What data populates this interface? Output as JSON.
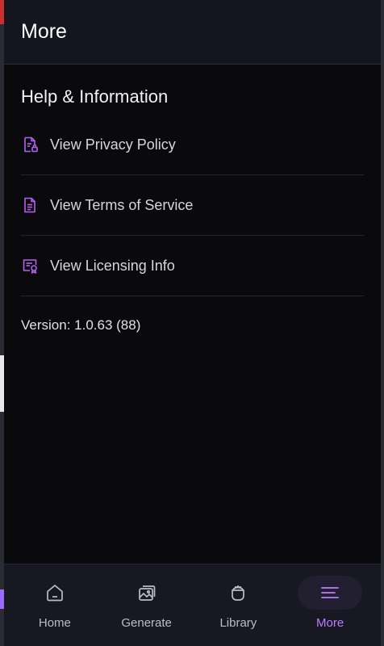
{
  "header": {
    "title": "More"
  },
  "section": {
    "title": "Help & Information"
  },
  "items": [
    {
      "label": "View Privacy Policy",
      "icon": "privacy-policy-icon"
    },
    {
      "label": "View Terms of Service",
      "icon": "document-icon"
    },
    {
      "label": "View Licensing Info",
      "icon": "license-certificate-icon"
    }
  ],
  "version": "Version: 1.0.63 (88)",
  "tabs": [
    {
      "label": "Home",
      "icon": "home-icon",
      "active": false
    },
    {
      "label": "Generate",
      "icon": "images-icon",
      "active": false
    },
    {
      "label": "Library",
      "icon": "library-icon",
      "active": false
    },
    {
      "label": "More",
      "icon": "menu-icon",
      "active": true
    }
  ],
  "colors": {
    "accent": "#c07bff",
    "background": "#0a0a0d",
    "header": "#151520",
    "tabbar": "#171821"
  }
}
